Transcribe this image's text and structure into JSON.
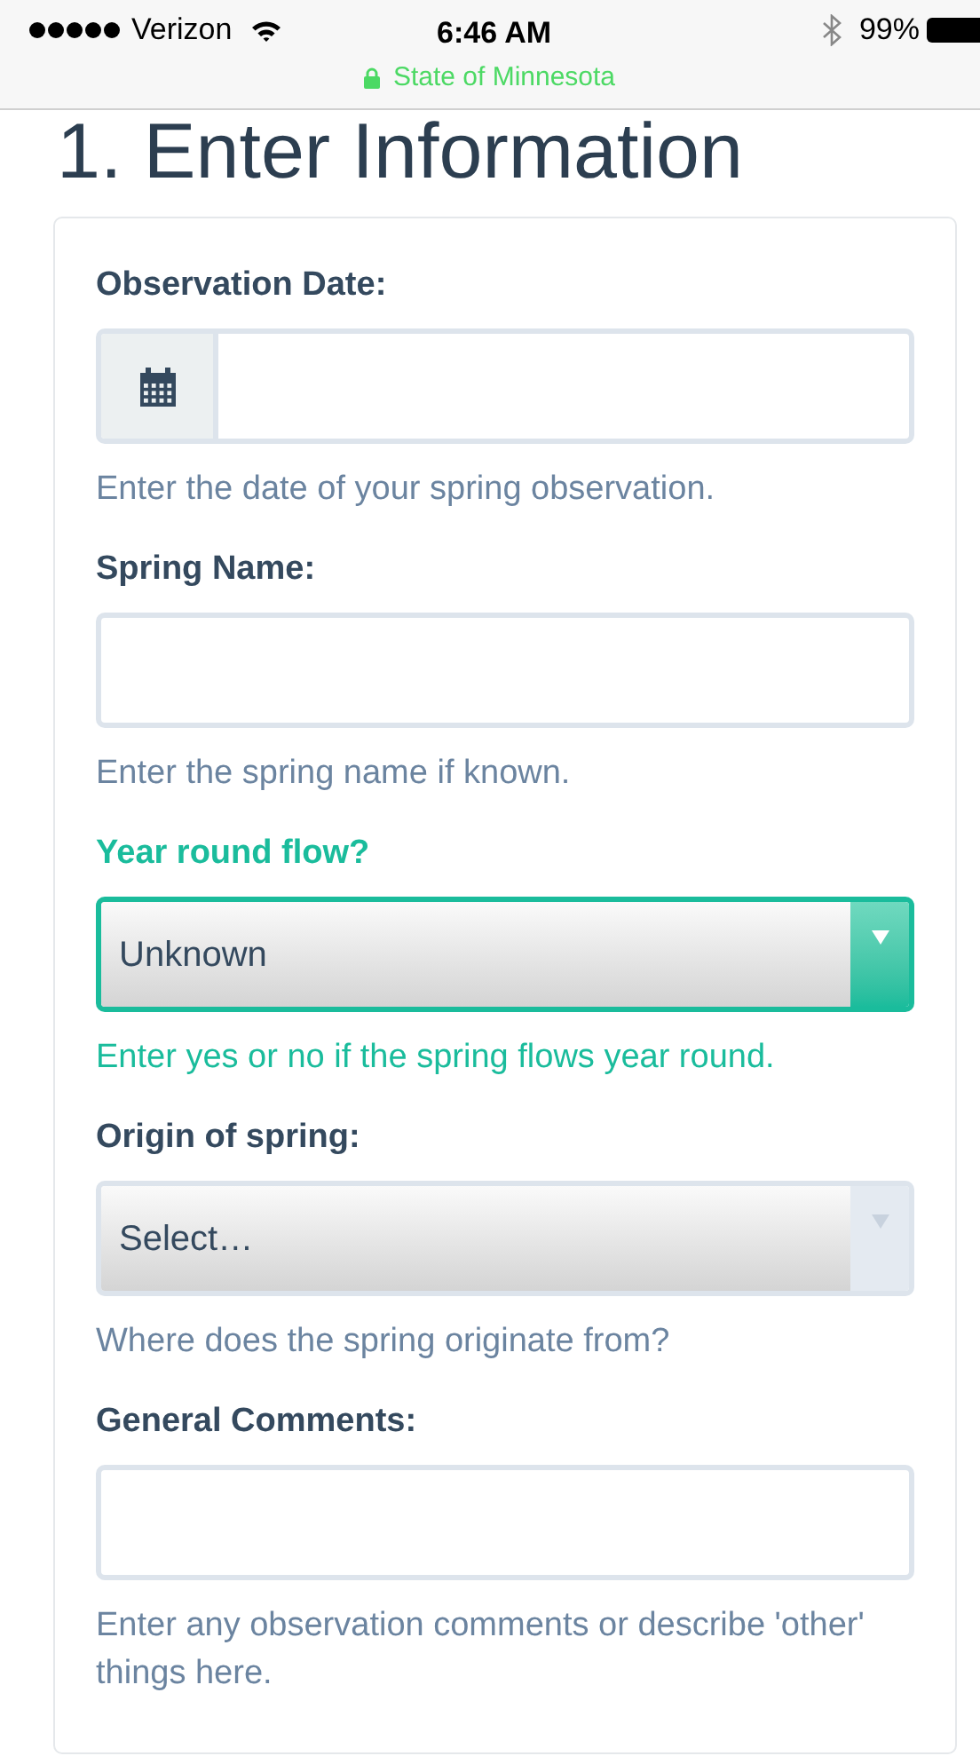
{
  "status_bar": {
    "carrier": "Verizon",
    "time": "6:46 AM",
    "battery": "99%",
    "site": "State of Minnesota"
  },
  "title": "1. Enter Information",
  "fields": [
    {
      "kind": "date",
      "label": "Observation Date:",
      "help": "Enter the date of your spring observation.",
      "highlighted": false
    },
    {
      "kind": "text",
      "label": "Spring Name:",
      "help": "Enter the spring name if known.",
      "highlighted": false
    },
    {
      "kind": "select",
      "label": "Year round flow?",
      "value": "Unknown",
      "help": "Enter yes or no if the spring flows year round.",
      "highlighted": true
    },
    {
      "kind": "select",
      "label": "Origin of spring:",
      "value": "Select…",
      "help": "Where does the spring originate from?",
      "highlighted": false
    },
    {
      "kind": "text",
      "label": "General Comments:",
      "help": "Enter any observation comments or describe 'other' things here.",
      "highlighted": false
    }
  ]
}
